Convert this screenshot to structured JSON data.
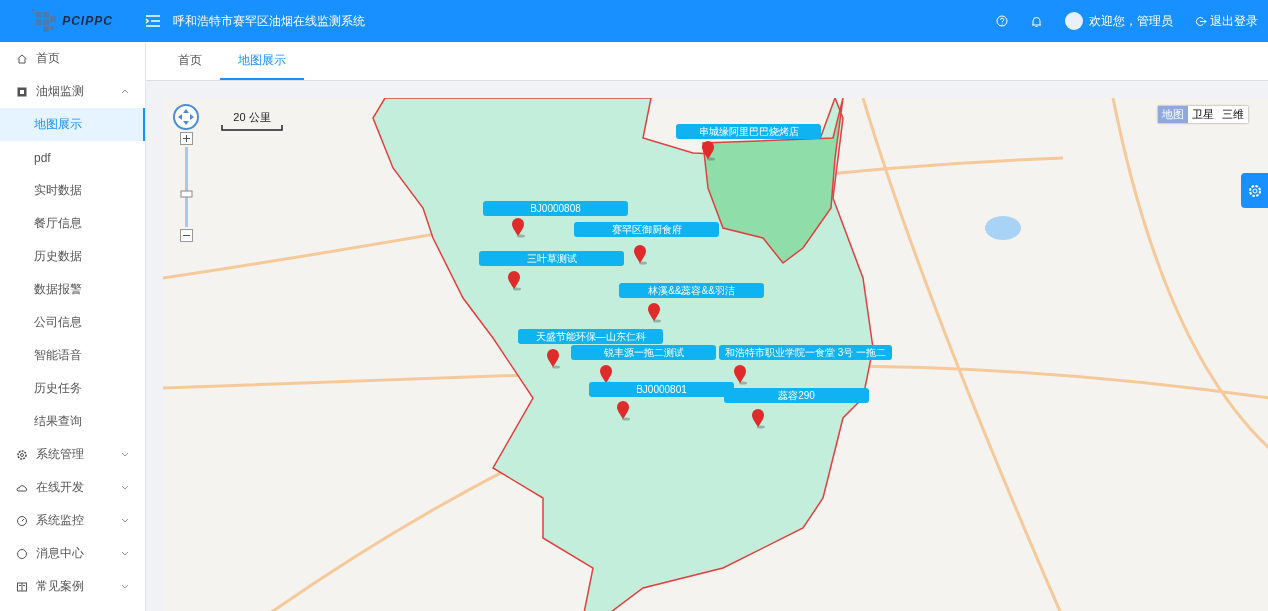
{
  "header": {
    "logo_text": "PCIPPC",
    "title": "呼和浩特市赛罕区油烟在线监测系统",
    "user": "欢迎您，管理员",
    "logout": "退出登录"
  },
  "sidebar": {
    "items": [
      {
        "label": "首页",
        "selected": false
      },
      {
        "label": "油烟监测",
        "expanded": true,
        "selected": false,
        "children": [
          {
            "label": "地图展示",
            "selected": true
          },
          {
            "label": "pdf",
            "selected": false
          },
          {
            "label": "实时数据",
            "selected": false
          },
          {
            "label": "餐厅信息",
            "selected": false
          },
          {
            "label": "历史数据",
            "selected": false
          },
          {
            "label": "数据报警",
            "selected": false
          },
          {
            "label": "公司信息",
            "selected": false
          },
          {
            "label": "智能语音",
            "selected": false
          },
          {
            "label": "历史任务",
            "selected": false
          },
          {
            "label": "结果查询",
            "selected": false
          }
        ]
      },
      {
        "label": "系统管理",
        "expanded": false,
        "selected": false
      },
      {
        "label": "在线开发",
        "expanded": false,
        "selected": false
      },
      {
        "label": "系统监控",
        "expanded": false,
        "selected": false
      },
      {
        "label": "消息中心",
        "expanded": false,
        "selected": false
      },
      {
        "label": "常见案例",
        "expanded": false,
        "selected": false
      }
    ]
  },
  "tabs": [
    {
      "label": "首页",
      "selected": false
    },
    {
      "label": "地图展示",
      "selected": true
    }
  ],
  "map": {
    "scale": "20 公里",
    "map_types": [
      {
        "label": "地图",
        "selected": true
      },
      {
        "label": "卫星",
        "selected": false
      },
      {
        "label": "三维",
        "selected": false
      }
    ],
    "markers": [
      {
        "label": "串城缘阿里巴巴烧烤店"
      },
      {
        "label": "BJ0000808"
      },
      {
        "label": "赛罕区御厨食府"
      },
      {
        "label": "三叶草测试"
      },
      {
        "label": "林溪&&蕊容&&羽洁"
      },
      {
        "label": "天盛节能环保—山东仁科"
      },
      {
        "label": "锐丰源一拖二测试"
      },
      {
        "label": "和浩特市职业学院一食堂 3号 一拖二"
      },
      {
        "label": "BJ0000801"
      },
      {
        "label": "蕊容290"
      }
    ]
  }
}
